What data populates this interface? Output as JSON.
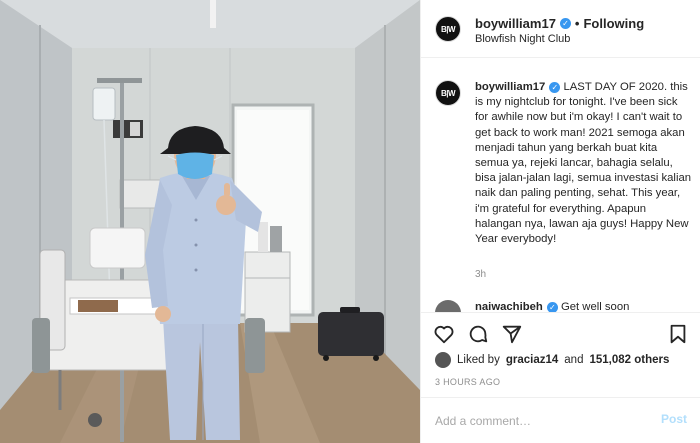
{
  "post": {
    "username": "boywilliam17",
    "avatar_text": "B|W",
    "follow_separator": "•",
    "follow_status": "Following",
    "location": "Blowfish Night Club",
    "caption": "LAST DAY OF 2020. this is my nightclub for tonight. I've been sick for awhile now but i'm okay! I can't wait to get back to work man! 2021 semoga akan menjadi tahun yang berkah buat kita semua ya, rejeki lancar, bahagia selalu, bisa jalan-jalan lagi, semua investasi kalian naik dan paling penting, sehat. This year, i'm grateful for everything. Apapun halangan nya, lawan aja guys! Happy New Year everybody!",
    "caption_time": "3h",
    "date": "3 HOURS AGO"
  },
  "comment_peek": {
    "username": "naiwachibeh",
    "text": "Get well soon"
  },
  "likes": {
    "prefix": "Liked by",
    "user": "graciaz14",
    "and": "and",
    "count": "151,082 others"
  },
  "comment_box": {
    "placeholder": "Add a comment…",
    "post_label": "Post"
  },
  "icons": [
    "heart-icon",
    "comment-icon",
    "share-icon",
    "bookmark-icon",
    "verified-badge-icon"
  ],
  "colors": {
    "verified": "#3897f0",
    "post_button_disabled": "#b2dffc",
    "muted_text": "#8e8e8e",
    "mask": "#5fb3e6",
    "pajamas": "#b8c6df"
  }
}
